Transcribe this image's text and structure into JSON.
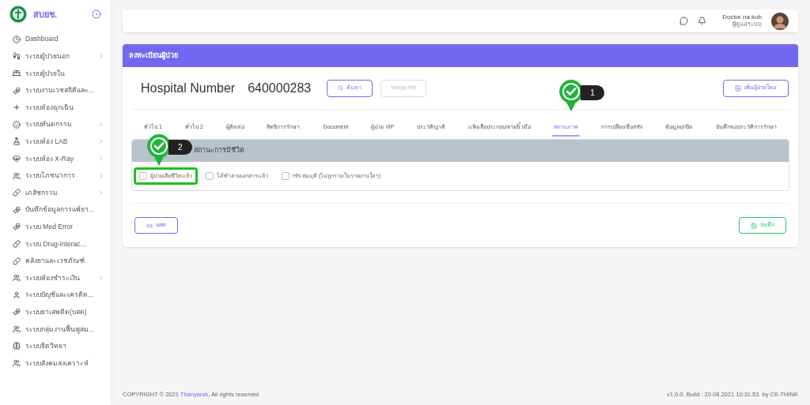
{
  "sidebar": {
    "logo_text": "สบยช.",
    "items": [
      {
        "label": "Dashboard",
        "submenu": false
      },
      {
        "label": "ระบบผู้ป่วยนอก",
        "submenu": true
      },
      {
        "label": "ระบบผู้ป่วยใน",
        "submenu": false
      },
      {
        "label": "ระบบงานเวชสถิติและ...",
        "submenu": false
      },
      {
        "label": "ระบบห้องฉุกเฉิน",
        "submenu": false
      },
      {
        "label": "ระบบทันตกรรม",
        "submenu": true
      },
      {
        "label": "ระบบห้อง LAB",
        "submenu": true
      },
      {
        "label": "ระบบห้อง X-Ray",
        "submenu": true
      },
      {
        "label": "ระบบโภชนาการ",
        "submenu": true
      },
      {
        "label": "เภสัชกรรม",
        "submenu": true
      },
      {
        "label": "บันทึกข้อมูลการแพ้ยา...",
        "submenu": false
      },
      {
        "label": "ระบบ Med Error",
        "submenu": false
      },
      {
        "label": "ระบบ Drug-Interac...",
        "submenu": false
      },
      {
        "label": "คลังยาและเวชภัณฑ์",
        "submenu": false
      },
      {
        "label": "ระบบห้องชำระเงิน",
        "submenu": true
      },
      {
        "label": "ระบบบัญชีและเครดิต...",
        "submenu": false
      },
      {
        "label": "ระบบยาเสพติด(บสต)",
        "submenu": false
      },
      {
        "label": "ระบบกลุ่มงานฟื้นฟูสม...",
        "submenu": false
      },
      {
        "label": "ระบบจิตวิทยา",
        "submenu": false
      },
      {
        "label": "ระบบสังคมสงเคราะห์",
        "submenu": false
      }
    ]
  },
  "topbar": {
    "user_name": "Doctor na kub",
    "user_role": "ผู้ดูแลระบบ"
  },
  "card": {
    "title": "ลงทะเบียนผู้ป่วย",
    "hn_label": "Hospital Number",
    "hn_value": "640000283",
    "buttons": [
      {
        "label": "ค้นหา",
        "kind": "search",
        "disabled": false
      },
      {
        "label": "Merge HN",
        "kind": "plain",
        "disabled": true
      }
    ],
    "add_button": "เพิ่มผู้ป่วยใหม่",
    "tabs": [
      {
        "label": "ทั่วไป 1",
        "selected": false
      },
      {
        "label": "ทั่วไป 2",
        "selected": false
      },
      {
        "label": "ผู้ติดต่อ",
        "selected": false
      },
      {
        "label": "สิทธิการรักษา",
        "selected": false
      },
      {
        "label": "Document",
        "selected": false
      },
      {
        "label": "ผู้ป่วย VIP",
        "selected": false
      },
      {
        "label": "ประวัติญาติ",
        "selected": false
      },
      {
        "label": "แฟ้มสื่อประกอบ/ลายนิ้วมือ",
        "selected": false
      },
      {
        "label": "สถานภาพ",
        "selected": true,
        "marker": "1"
      },
      {
        "label": "การเปลี่ยนชื่อ/HN",
        "selected": false
      },
      {
        "label": "ข้อมูลปกปิด",
        "selected": false
      },
      {
        "label": "บันทึกขอประวัติการรักษา",
        "selected": false
      }
    ],
    "section": {
      "title": "สถานะการมีชีวิต",
      "marker": "2",
      "checkboxes": [
        {
          "label": "ผู้ป่วยเสียชีวิตแล้ว",
          "checked": false,
          "highlighted": true
        },
        {
          "label": "ได้ทำลายเอกสารแล้ว",
          "checked": false,
          "highlighted": false
        },
        {
          "label": "HN สมมุติ (ไม่ถูกรวมในรายงานใดๆ)",
          "checked": false,
          "highlighted": false
        }
      ]
    },
    "link_button": "บสต",
    "save_button": "บันทึก"
  },
  "footer": {
    "copyright": "COPYRIGHT © 2021",
    "brand": "Thanyarak",
    "rights": ", All rights reserved",
    "build": "v1.0.0. Build : 20.08.2021 10:31:53. by CK-THINK"
  }
}
